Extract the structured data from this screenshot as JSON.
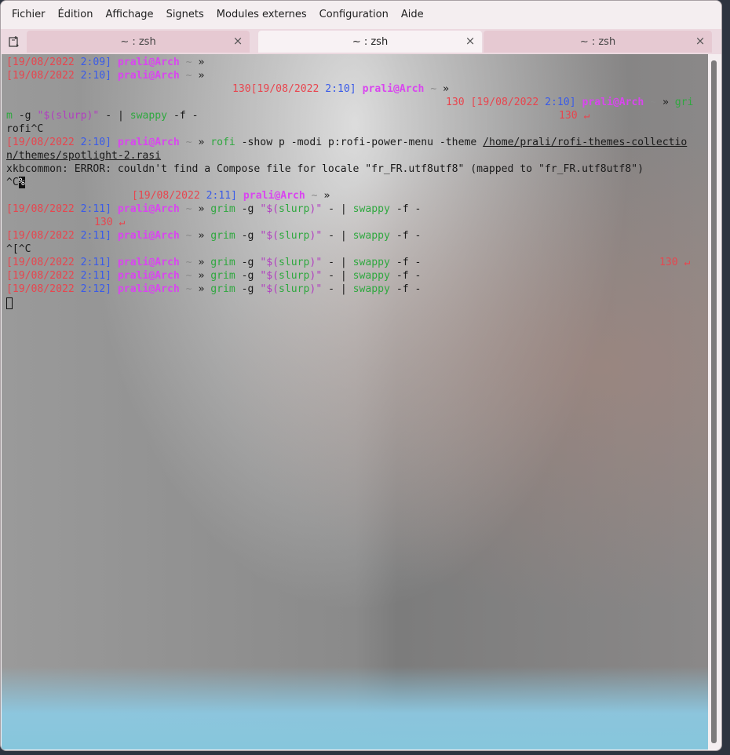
{
  "menubar": {
    "items": [
      "Fichier",
      "Édition",
      "Affichage",
      "Signets",
      "Modules externes",
      "Configuration",
      "Aide"
    ]
  },
  "tabs": [
    {
      "label": "~ : zsh",
      "active": false
    },
    {
      "label": "~ : zsh",
      "active": true
    },
    {
      "label": "~ : zsh",
      "active": false
    }
  ],
  "terminal": {
    "date": "[19/08/2022",
    "times": [
      "2:09]",
      "2:10]",
      "2:10]",
      "2:10]",
      "2:10]",
      "2:11]",
      "2:11]",
      "2:11]",
      "2:11]",
      "2:11]",
      "2:12]"
    ],
    "user": "prali@Arch",
    "tilde": "~",
    "chevron": "»",
    "exit_code": "130",
    "return_icon": "↵",
    "line3_prefix": "130[19/08/2022",
    "line4_prefix": "130",
    "line4_cmd": "gri",
    "line5_a": "m",
    "line5_b": "-g",
    "line5_c": "\"$(slurp)\"",
    "line5_d": "- |",
    "line5_e": "swappy",
    "line5_f": "-f -",
    "line6": "rofi^C",
    "rofi": "rofi",
    "rofi_args": "-show p -modi p:rofi-power-menu -theme",
    "rofi_path1": "/home/prali/rofi-themes-collectio",
    "rofi_path2": "n/themes/spotlight-2.rasi",
    "xkb_error": "xkbcommon: ERROR: couldn't find a Compose file for locale \"fr_FR.utf8utf8\" (mapped to \"fr_FR.utf8utf8\")",
    "ctrl_c": "^C",
    "percent": "%",
    "grim": "grim",
    "grim_g": "-g",
    "slurp_q1": "\"",
    "slurp_dollar": "$(",
    "slurp": "slurp",
    "slurp_close": ")",
    "slurp_q2": "\"",
    "pipe": "- |",
    "swappy": "swappy",
    "swappy_f": "-f -",
    "esc_ctrl_c": "^[^C"
  },
  "colors": {
    "date_red": "#e8454e",
    "time_blue": "#3a5be8",
    "user_magenta": "#d946ef",
    "cmd_green": "#2fa83f",
    "tab_bar": "#ecd9e0"
  },
  "icons": [
    "new-tab-icon",
    "close-icon",
    "return-icon"
  ]
}
